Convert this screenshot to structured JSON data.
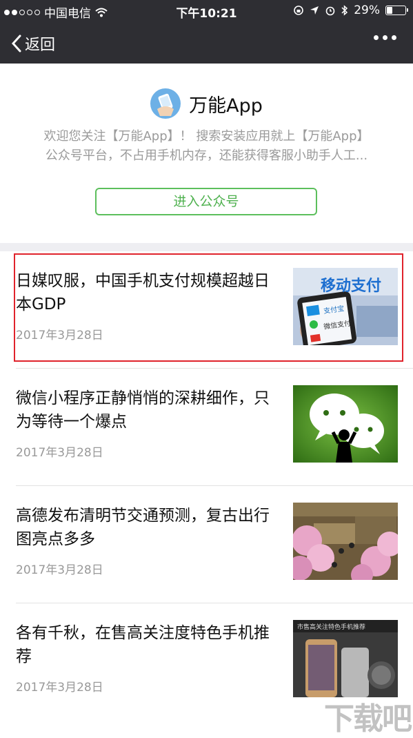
{
  "status_bar": {
    "carrier": "中国电信",
    "time": "下午10:21",
    "battery_percent": "29%",
    "battery_level": 0.29,
    "signal_dots_filled": 2,
    "signal_dots_total": 5
  },
  "nav": {
    "back_label": "返回",
    "more_icon": "ellipsis-icon"
  },
  "account": {
    "name": "万能App",
    "description_line1": "欢迎您关注【万能App】！ 搜索安装应用就上【万能App】",
    "description_line2": "公众号平台，不占用手机内存，还能获得客服小助手人工...",
    "enter_button": "进入公众号",
    "logo_icon": "app-logo-icon"
  },
  "articles": [
    {
      "title": "日媒叹服，中国手机支付规模超越日本GDP",
      "date": "2017年3月28日",
      "thumb_text": "移动支付",
      "thumb_app1": "支付宝",
      "thumb_app2": "微信支付",
      "highlighted": true
    },
    {
      "title": "微信小程序正静悄悄的深耕细作，只为等待一个爆点",
      "date": "2017年3月28日",
      "highlighted": false
    },
    {
      "title": "高德发布清明节交通预测，复古出行图亮点多多",
      "date": "2017年3月28日",
      "highlighted": false
    },
    {
      "title": "各有千秋，在售高关注度特色手机推荐",
      "date": "2017年3月28日",
      "thumb_text": "市售高关注特色手机推荐",
      "highlighted": false
    }
  ],
  "watermark": "下载吧",
  "colors": {
    "nav_bg": "#2e2e33",
    "accent_green": "#4fb14f",
    "highlight_red": "#e0222b"
  }
}
